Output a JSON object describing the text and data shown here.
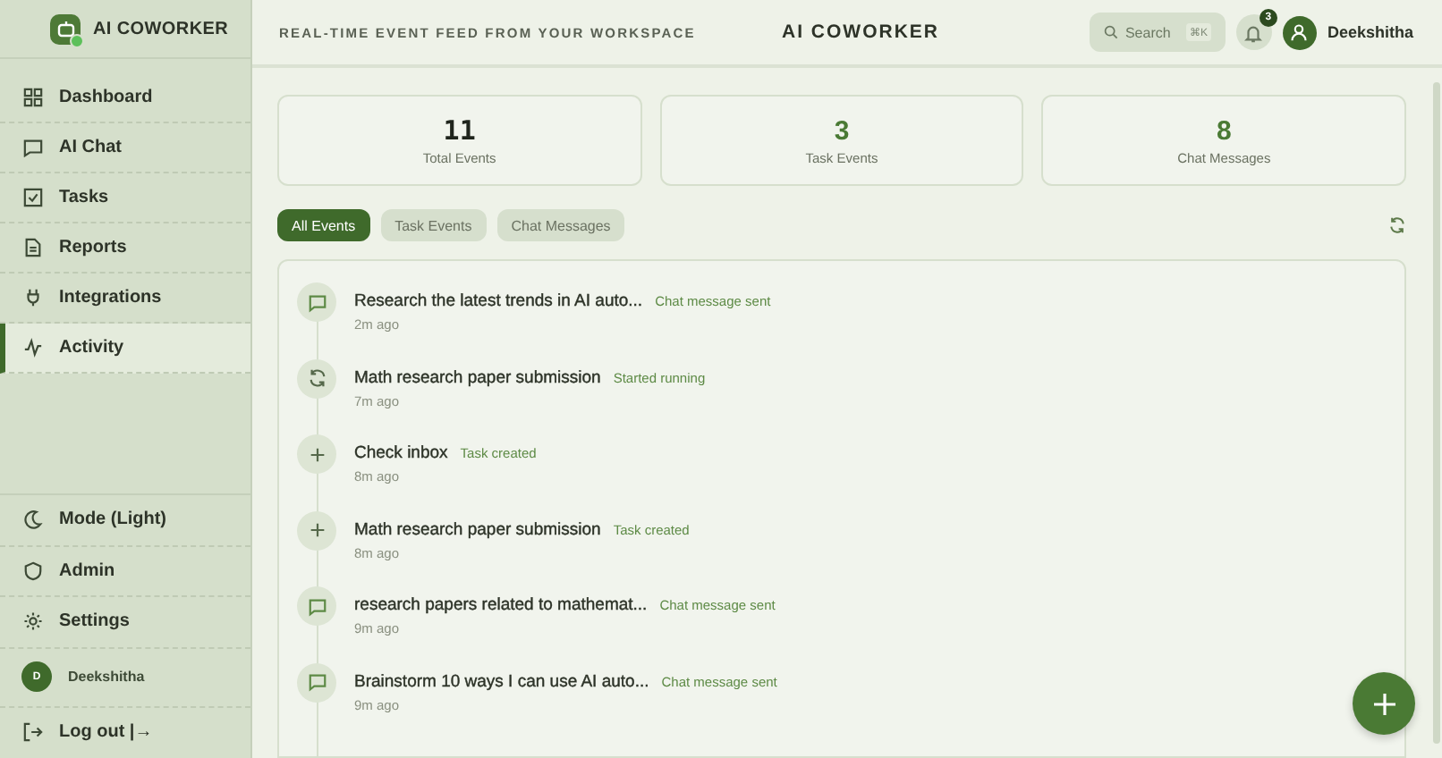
{
  "brand": {
    "name": "AI COWORKER"
  },
  "sidebar": {
    "items": [
      {
        "label": "Dashboard",
        "selected": false
      },
      {
        "label": "AI Chat",
        "selected": false
      },
      {
        "label": "Tasks",
        "selected": false
      },
      {
        "label": "Reports",
        "selected": false
      },
      {
        "label": "Integrations",
        "selected": false
      },
      {
        "label": "Activity",
        "selected": true
      }
    ],
    "bottom_items": [
      {
        "label": "Mode (Light)"
      },
      {
        "label": "Admin"
      },
      {
        "label": "Settings"
      }
    ],
    "user": {
      "initial": "D",
      "name": "Deekshitha"
    },
    "logout": "Log out |→"
  },
  "header": {
    "subtitle": "REAL-TIME EVENT FEED FROM YOUR WORKSPACE",
    "title": "AI COWORKER",
    "search": {
      "placeholder": "Search",
      "shortcut": "⌘K"
    },
    "notifications": "3",
    "user": "Deekshitha"
  },
  "stats": [
    {
      "value": "11",
      "label": "Total Events",
      "accent": false
    },
    {
      "value": "3",
      "label": "Task Events",
      "accent": true
    },
    {
      "value": "8",
      "label": "Chat Messages",
      "accent": true
    }
  ],
  "filters": [
    {
      "label": "All Events",
      "selected": true
    },
    {
      "label": "Task Events",
      "selected": false
    },
    {
      "label": "Chat Messages",
      "selected": false
    }
  ],
  "events": [
    {
      "kind": "chat",
      "title": "Research the latest trends in AI auto...",
      "status": "Chat message sent",
      "time": "2m ago"
    },
    {
      "kind": "running",
      "title": "Math research paper submission",
      "status": "Started running",
      "time": "7m ago"
    },
    {
      "kind": "created",
      "title": "Check inbox",
      "status": "Task created",
      "time": "8m ago"
    },
    {
      "kind": "created",
      "title": "Math research paper submission",
      "status": "Task created",
      "time": "8m ago"
    },
    {
      "kind": "chat",
      "title": "research papers related to mathemat...",
      "status": "Chat message sent",
      "time": "9m ago"
    },
    {
      "kind": "chat",
      "title": "Brainstorm 10 ways I can use AI auto...",
      "status": "Chat message sent",
      "time": "9m ago"
    }
  ]
}
